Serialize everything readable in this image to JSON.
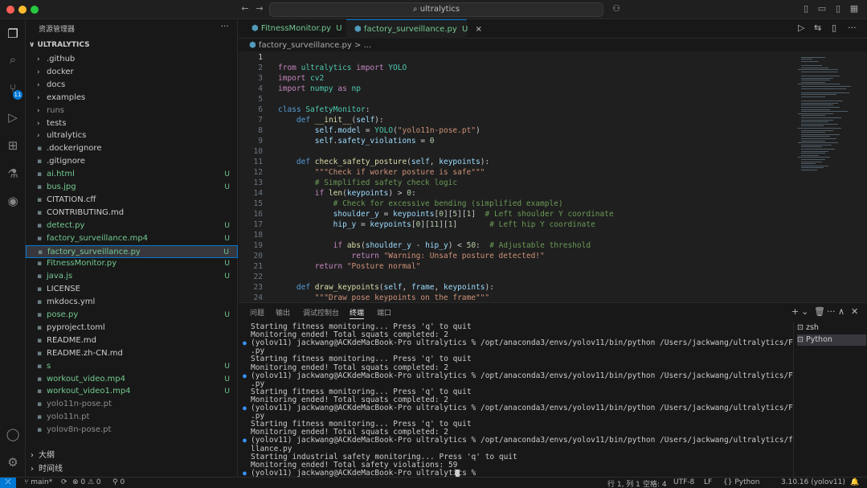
{
  "titlebar": {
    "search": "ultralytics",
    "colors": {
      "close": "#ff5f57",
      "minimize": "#febc2e",
      "maximize": "#28c840"
    }
  },
  "activity": {
    "source_control_badge": "11",
    "icons": [
      "explorer-icon",
      "search-icon",
      "source-control-icon",
      "run-debug-icon",
      "extensions-icon",
      "testing-icon",
      "remote-icon",
      "account-icon",
      "settings-gear-icon"
    ]
  },
  "sidebar": {
    "title": "资源管理器",
    "more": "···",
    "root": "ULTRALYTICS",
    "items": [
      {
        "label": ".github",
        "type": "folder",
        "color": "#cccccc",
        "status": ""
      },
      {
        "label": "docker",
        "type": "folder",
        "color": "#cccccc",
        "status": ""
      },
      {
        "label": "docs",
        "type": "folder",
        "color": "#cccccc",
        "status": ""
      },
      {
        "label": "examples",
        "type": "folder",
        "color": "#cccccc",
        "status": ""
      },
      {
        "label": "runs",
        "type": "folder",
        "color": "#8c8c8c",
        "status": ""
      },
      {
        "label": "tests",
        "type": "folder",
        "color": "#cccccc",
        "status": ""
      },
      {
        "label": "ultralytics",
        "type": "folder",
        "color": "#cccccc",
        "status": ""
      },
      {
        "label": ".dockerignore",
        "type": "file",
        "color": "#cccccc",
        "status": ""
      },
      {
        "label": ".gitignore",
        "type": "file",
        "color": "#cccccc",
        "status": ""
      },
      {
        "label": "ai.html",
        "type": "file",
        "color": "#73c991",
        "status": "U"
      },
      {
        "label": "bus.jpg",
        "type": "file",
        "color": "#73c991",
        "status": "U"
      },
      {
        "label": "CITATION.cff",
        "type": "file",
        "color": "#cccccc",
        "status": ""
      },
      {
        "label": "CONTRIBUTING.md",
        "type": "file",
        "color": "#cccccc",
        "status": ""
      },
      {
        "label": "detect.py",
        "type": "file",
        "color": "#73c991",
        "status": "U"
      },
      {
        "label": "factory_surveillance.mp4",
        "type": "file",
        "color": "#73c991",
        "status": "U"
      },
      {
        "label": "factory_surveillance.py",
        "type": "file",
        "color": "#73c991",
        "status": "U"
      },
      {
        "label": "FitnessMonitor.py",
        "type": "file",
        "color": "#73c991",
        "status": "U"
      },
      {
        "label": "java.js",
        "type": "file",
        "color": "#73c991",
        "status": "U"
      },
      {
        "label": "LICENSE",
        "type": "file",
        "color": "#cccccc",
        "status": ""
      },
      {
        "label": "mkdocs.yml",
        "type": "file",
        "color": "#cccccc",
        "status": ""
      },
      {
        "label": "pose.py",
        "type": "file",
        "color": "#73c991",
        "status": "U"
      },
      {
        "label": "pyproject.toml",
        "type": "file",
        "color": "#cccccc",
        "status": ""
      },
      {
        "label": "README.md",
        "type": "file",
        "color": "#cccccc",
        "status": ""
      },
      {
        "label": "README.zh-CN.md",
        "type": "file",
        "color": "#cccccc",
        "status": ""
      },
      {
        "label": "s",
        "type": "file",
        "color": "#73c991",
        "status": "U"
      },
      {
        "label": "workout_video.mp4",
        "type": "file",
        "color": "#73c991",
        "status": "U"
      },
      {
        "label": "workout_video1.mp4",
        "type": "file",
        "color": "#73c991",
        "status": "U"
      },
      {
        "label": "yolo11n-pose.pt",
        "type": "file",
        "color": "#8c8c8c",
        "status": ""
      },
      {
        "label": "yolo11n.pt",
        "type": "file",
        "color": "#8c8c8c",
        "status": ""
      },
      {
        "label": "yolov8n-pose.pt",
        "type": "file",
        "color": "#8c8c8c",
        "status": ""
      }
    ],
    "outline": "大纲",
    "timeline": "时间线"
  },
  "tabs": [
    {
      "label": "FitnessMonitor.py",
      "status": "U",
      "active": false
    },
    {
      "label": "factory_surveillance.py",
      "status": "U",
      "active": true
    }
  ],
  "breadcrumb": "factory_surveillance.py > ...",
  "editor": {
    "lines": [
      [],
      [
        [
          "kw",
          "from "
        ],
        [
          "cls",
          "ultralytics "
        ],
        [
          "kw",
          "import "
        ],
        [
          "cls",
          "YOLO"
        ]
      ],
      [
        [
          "kw",
          "import "
        ],
        [
          "cls",
          "cv2"
        ]
      ],
      [
        [
          "kw",
          "import "
        ],
        [
          "cls",
          "numpy "
        ],
        [
          "kw",
          "as "
        ],
        [
          "cls",
          "np"
        ]
      ],
      [],
      [
        [
          "def",
          "class "
        ],
        [
          "cls",
          "SafetyMonitor"
        ],
        [
          "t",
          ":"
        ]
      ],
      [
        [
          "t",
          "    "
        ],
        [
          "def",
          "def "
        ],
        [
          "fn",
          "__init__"
        ],
        [
          "t",
          "("
        ],
        [
          "var",
          "self"
        ],
        [
          "t",
          "):"
        ]
      ],
      [
        [
          "t",
          "        "
        ],
        [
          "var",
          "self"
        ],
        [
          "t",
          "."
        ],
        [
          "var",
          "model"
        ],
        [
          "t",
          " = "
        ],
        [
          "cls",
          "YOLO"
        ],
        [
          "t",
          "("
        ],
        [
          "str",
          "\"yolo11n-pose.pt\""
        ],
        [
          "t",
          ")"
        ]
      ],
      [
        [
          "t",
          "        "
        ],
        [
          "var",
          "self"
        ],
        [
          "t",
          "."
        ],
        [
          "var",
          "safety_violations"
        ],
        [
          "t",
          " = "
        ],
        [
          "num",
          "0"
        ]
      ],
      [],
      [
        [
          "t",
          "    "
        ],
        [
          "def",
          "def "
        ],
        [
          "fn",
          "check_safety_posture"
        ],
        [
          "t",
          "("
        ],
        [
          "var",
          "self"
        ],
        [
          "t",
          ", "
        ],
        [
          "var",
          "keypoints"
        ],
        [
          "t",
          "):"
        ]
      ],
      [
        [
          "t",
          "        "
        ],
        [
          "str",
          "\"\"\"Check if worker posture is safe\"\"\""
        ]
      ],
      [
        [
          "t",
          "        "
        ],
        [
          "cmt",
          "# Simplified safety check logic"
        ]
      ],
      [
        [
          "t",
          "        "
        ],
        [
          "kw",
          "if "
        ],
        [
          "fn",
          "len"
        ],
        [
          "t",
          "("
        ],
        [
          "var",
          "keypoints"
        ],
        [
          "t",
          ") > "
        ],
        [
          "num",
          "0"
        ],
        [
          "t",
          ":"
        ]
      ],
      [
        [
          "t",
          "            "
        ],
        [
          "cmt",
          "# Check for excessive bending (simplified example)"
        ]
      ],
      [
        [
          "t",
          "            "
        ],
        [
          "var",
          "shoulder_y"
        ],
        [
          "t",
          " = "
        ],
        [
          "var",
          "keypoints"
        ],
        [
          "t",
          "["
        ],
        [
          "num",
          "0"
        ],
        [
          "t",
          "]["
        ],
        [
          "num",
          "5"
        ],
        [
          "t",
          "]["
        ],
        [
          "num",
          "1"
        ],
        [
          "t",
          "]  "
        ],
        [
          "cmt",
          "# Left shoulder Y coordinate"
        ]
      ],
      [
        [
          "t",
          "            "
        ],
        [
          "var",
          "hip_y"
        ],
        [
          "t",
          " = "
        ],
        [
          "var",
          "keypoints"
        ],
        [
          "t",
          "["
        ],
        [
          "num",
          "0"
        ],
        [
          "t",
          "]["
        ],
        [
          "num",
          "11"
        ],
        [
          "t",
          "]["
        ],
        [
          "num",
          "1"
        ],
        [
          "t",
          "]       "
        ],
        [
          "cmt",
          "# Left hip Y coordinate"
        ]
      ],
      [],
      [
        [
          "t",
          "            "
        ],
        [
          "kw",
          "if "
        ],
        [
          "fn",
          "abs"
        ],
        [
          "t",
          "("
        ],
        [
          "var",
          "shoulder_y"
        ],
        [
          "t",
          " - "
        ],
        [
          "var",
          "hip_y"
        ],
        [
          "t",
          ") < "
        ],
        [
          "num",
          "50"
        ],
        [
          "t",
          ":  "
        ],
        [
          "cmt",
          "# Adjustable threshold"
        ]
      ],
      [
        [
          "t",
          "                "
        ],
        [
          "kw",
          "return "
        ],
        [
          "str",
          "\"Warning: Unsafe posture detected!\""
        ]
      ],
      [
        [
          "t",
          "        "
        ],
        [
          "kw",
          "return "
        ],
        [
          "str",
          "\"Posture normal\""
        ]
      ],
      [],
      [
        [
          "t",
          "    "
        ],
        [
          "def",
          "def "
        ],
        [
          "fn",
          "draw_keypoints"
        ],
        [
          "t",
          "("
        ],
        [
          "var",
          "self"
        ],
        [
          "t",
          ", "
        ],
        [
          "var",
          "frame"
        ],
        [
          "t",
          ", "
        ],
        [
          "var",
          "keypoints"
        ],
        [
          "t",
          "):"
        ]
      ],
      [
        [
          "t",
          "        "
        ],
        [
          "str",
          "\"\"\"Draw pose keypoints on the frame\"\"\""
        ]
      ]
    ]
  },
  "panel": {
    "tabs": [
      "问题",
      "输出",
      "调试控制台",
      "终端",
      "端口"
    ],
    "active_tab": 3,
    "actions": [
      "+ ∨",
      "🗑",
      "···",
      "∧",
      "✕"
    ],
    "terminal": [
      {
        "bullet": false,
        "text": "Starting fitness monitoring... Press 'q' to quit"
      },
      {
        "bullet": false,
        "text": "Monitoring ended! Total squats completed: 2"
      },
      {
        "bullet": true,
        "text": "(yolov11) jackwang@ACKdeMacBook-Pro ultralytics % /opt/anaconda3/envs/yolov11/bin/python /Users/jackwang/ultralytics/FitnessMonitor"
      },
      {
        "bullet": false,
        "text": ".py"
      },
      {
        "bullet": false,
        "text": "Starting fitness monitoring... Press 'q' to quit"
      },
      {
        "bullet": false,
        "text": "Monitoring ended! Total squats completed: 2"
      },
      {
        "bullet": true,
        "text": "(yolov11) jackwang@ACKdeMacBook-Pro ultralytics % /opt/anaconda3/envs/yolov11/bin/python /Users/jackwang/ultralytics/FitnessMonitor"
      },
      {
        "bullet": false,
        "text": ".py"
      },
      {
        "bullet": false,
        "text": "Starting fitness monitoring... Press 'q' to quit"
      },
      {
        "bullet": false,
        "text": "Monitoring ended! Total squats completed: 2"
      },
      {
        "bullet": true,
        "text": "(yolov11) jackwang@ACKdeMacBook-Pro ultralytics % /opt/anaconda3/envs/yolov11/bin/python /Users/jackwang/ultralytics/FitnessMonitor"
      },
      {
        "bullet": false,
        "text": ".py"
      },
      {
        "bullet": false,
        "text": "Starting fitness monitoring... Press 'q' to quit"
      },
      {
        "bullet": false,
        "text": "Monitoring ended! Total squats completed: 2"
      },
      {
        "bullet": true,
        "text": "(yolov11) jackwang@ACKdeMacBook-Pro ultralytics % /opt/anaconda3/envs/yolov11/bin/python /Users/jackwang/ultralytics/factory_survei"
      },
      {
        "bullet": false,
        "text": "llance.py"
      },
      {
        "bullet": false,
        "text": "Starting industrial safety monitoring... Press 'q' to quit"
      },
      {
        "bullet": false,
        "text": "Monitoring ended! Total safety violations: 59"
      },
      {
        "bullet": true,
        "text": "(yolov11) jackwang@ACKdeMacBook-Pro ultralytics % "
      }
    ],
    "terminals": [
      {
        "label": "zsh",
        "selected": false
      },
      {
        "label": "Python",
        "selected": true
      }
    ]
  },
  "statusbar": {
    "remote": "⤫",
    "branch": "main*",
    "sync": "⟳",
    "errors": "⊗ 0 ⚠ 0",
    "ports": "⚲ 0",
    "position": "行 1, 列 1",
    "spaces": "空格: 4",
    "encoding": "UTF-8",
    "eol": "LF",
    "language": "{} Python",
    "interpreter": "3.10.16 (yolov11)",
    "bell": "🔔"
  }
}
